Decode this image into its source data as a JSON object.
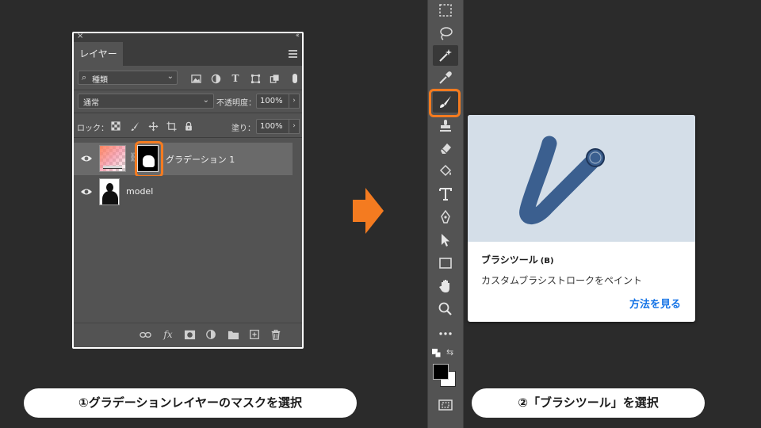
{
  "layers_panel": {
    "tab_label": "レイヤー",
    "filter": {
      "selected": "種類"
    },
    "blend_mode": "通常",
    "opacity_label": "不透明度：",
    "opacity_value": "100%",
    "lock_label": "ロック：",
    "fill_label": "塗り：",
    "fill_value": "100%",
    "layers": [
      {
        "name": "グラデーション 1",
        "selected": true,
        "visible": true
      },
      {
        "name": "model",
        "selected": false,
        "visible": true
      }
    ]
  },
  "tooltip": {
    "title": "ブラシツール",
    "shortcut": "(B)",
    "description": "カスタムブラシストロークをペイント",
    "link": "方法を見る"
  },
  "captions": {
    "step1": "①グラデーションレイヤーのマスクを選択",
    "step2": "②「ブラシツール」を選択"
  },
  "colors": {
    "highlight": "#f47b20",
    "link": "#1473e6",
    "stroke": "#3b5f8f",
    "preview_bg": "#d4dee8"
  },
  "toolbar_icons": [
    "marquee-icon",
    "lasso-icon",
    "magic-wand-icon",
    "eyedropper-icon",
    "brush-icon",
    "clone-stamp-icon",
    "eraser-icon",
    "paint-bucket-icon",
    "type-icon",
    "pen-icon",
    "move-selection-icon",
    "rectangle-icon",
    "hand-icon",
    "zoom-icon",
    "more-tools-icon"
  ]
}
